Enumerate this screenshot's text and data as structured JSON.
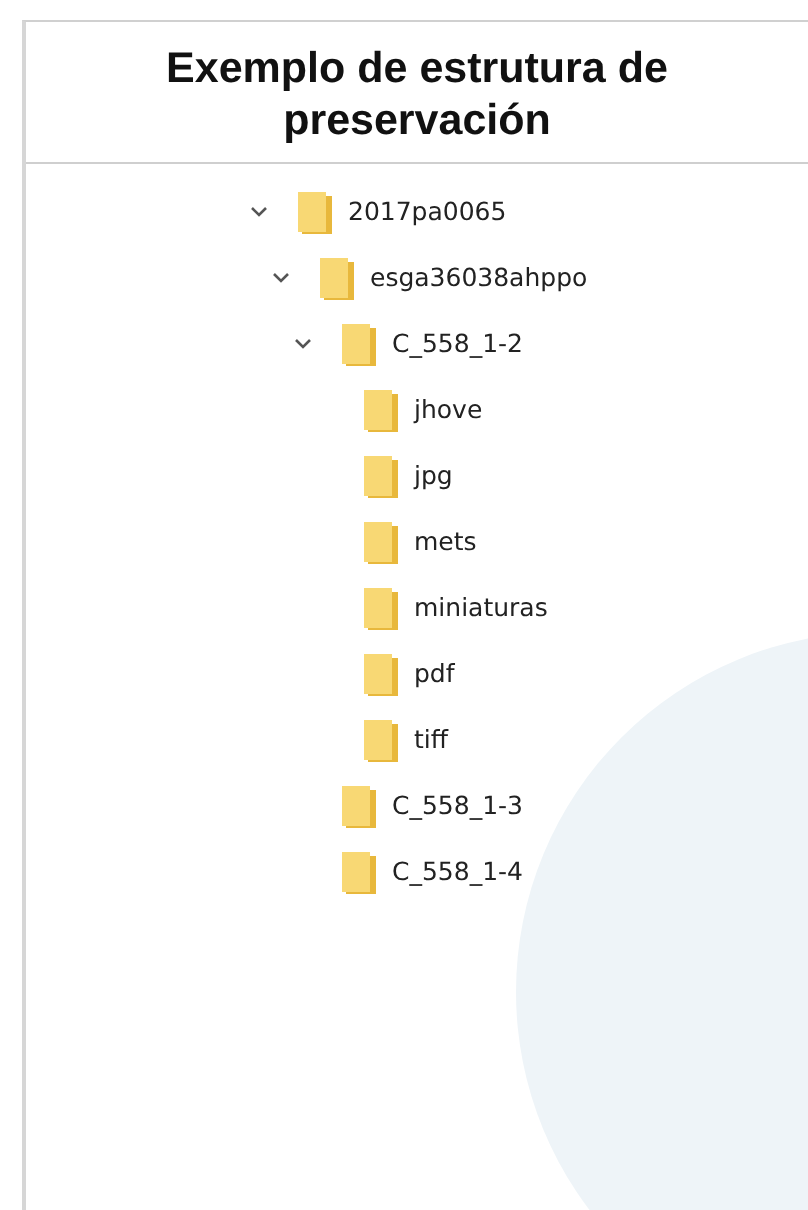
{
  "title": "Exemplo de estrutura de preservación",
  "tree": [
    {
      "label": "2017pa0065",
      "expanded": true,
      "children": [
        {
          "label": "esga36038ahppo",
          "expanded": true,
          "children": [
            {
              "label": "C_558_1-2",
              "expanded": true,
              "children": [
                {
                  "label": "jhove",
                  "expanded": false
                },
                {
                  "label": "jpg",
                  "expanded": false
                },
                {
                  "label": "mets",
                  "expanded": false
                },
                {
                  "label": "miniaturas",
                  "expanded": false
                },
                {
                  "label": "pdf",
                  "expanded": false
                },
                {
                  "label": "tiff",
                  "expanded": false
                }
              ]
            },
            {
              "label": "C_558_1-3",
              "expanded": false
            },
            {
              "label": "C_558_1-4",
              "expanded": false
            }
          ]
        }
      ]
    }
  ]
}
